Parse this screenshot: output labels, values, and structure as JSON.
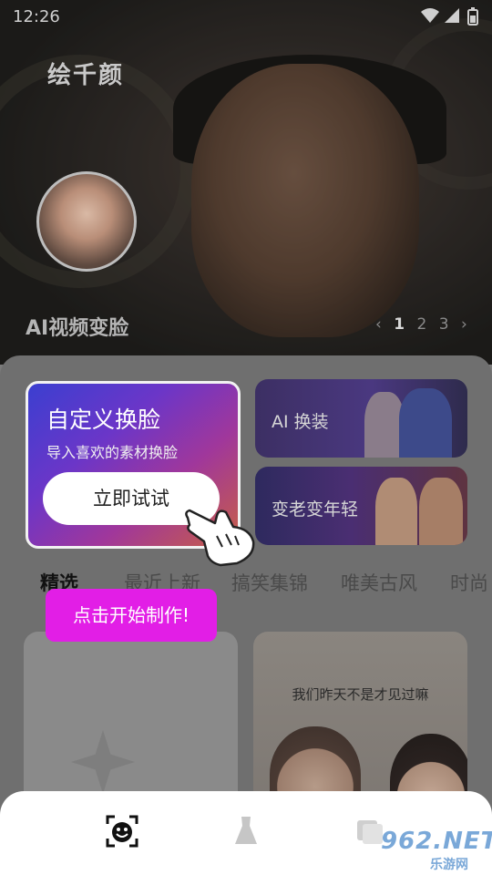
{
  "status_bar": {
    "time": "12:26"
  },
  "header": {
    "app_title": "绘千颜"
  },
  "banner": {
    "caption": "AI视频变脸",
    "pager": [
      "1",
      "2",
      "3"
    ],
    "active_page": "1"
  },
  "custom_card": {
    "title": "自定义换脸",
    "subtitle": "导入喜欢的素材换脸",
    "button": "立即试试"
  },
  "side_cards": [
    {
      "label": "AI 换装"
    },
    {
      "label": "变老变年轻"
    }
  ],
  "tabs": [
    "精选",
    "最近上新",
    "搞笑集锦",
    "唯美古风",
    "时尚"
  ],
  "tooltip": "点击开始制作!",
  "content_tiles": [
    {
      "caption": ""
    },
    {
      "caption": "我们昨天不是才见过嘛"
    }
  ],
  "bottom_nav": {
    "items": [
      "face-swap-icon",
      "dress-icon",
      "cards-icon"
    ]
  },
  "watermark": {
    "number": "962.NET",
    "text": "乐游网"
  },
  "colors": {
    "tooltip_bg": "#e21ee6",
    "card_gradient_start": "#3b3fd0",
    "card_gradient_end": "#c85f45"
  }
}
